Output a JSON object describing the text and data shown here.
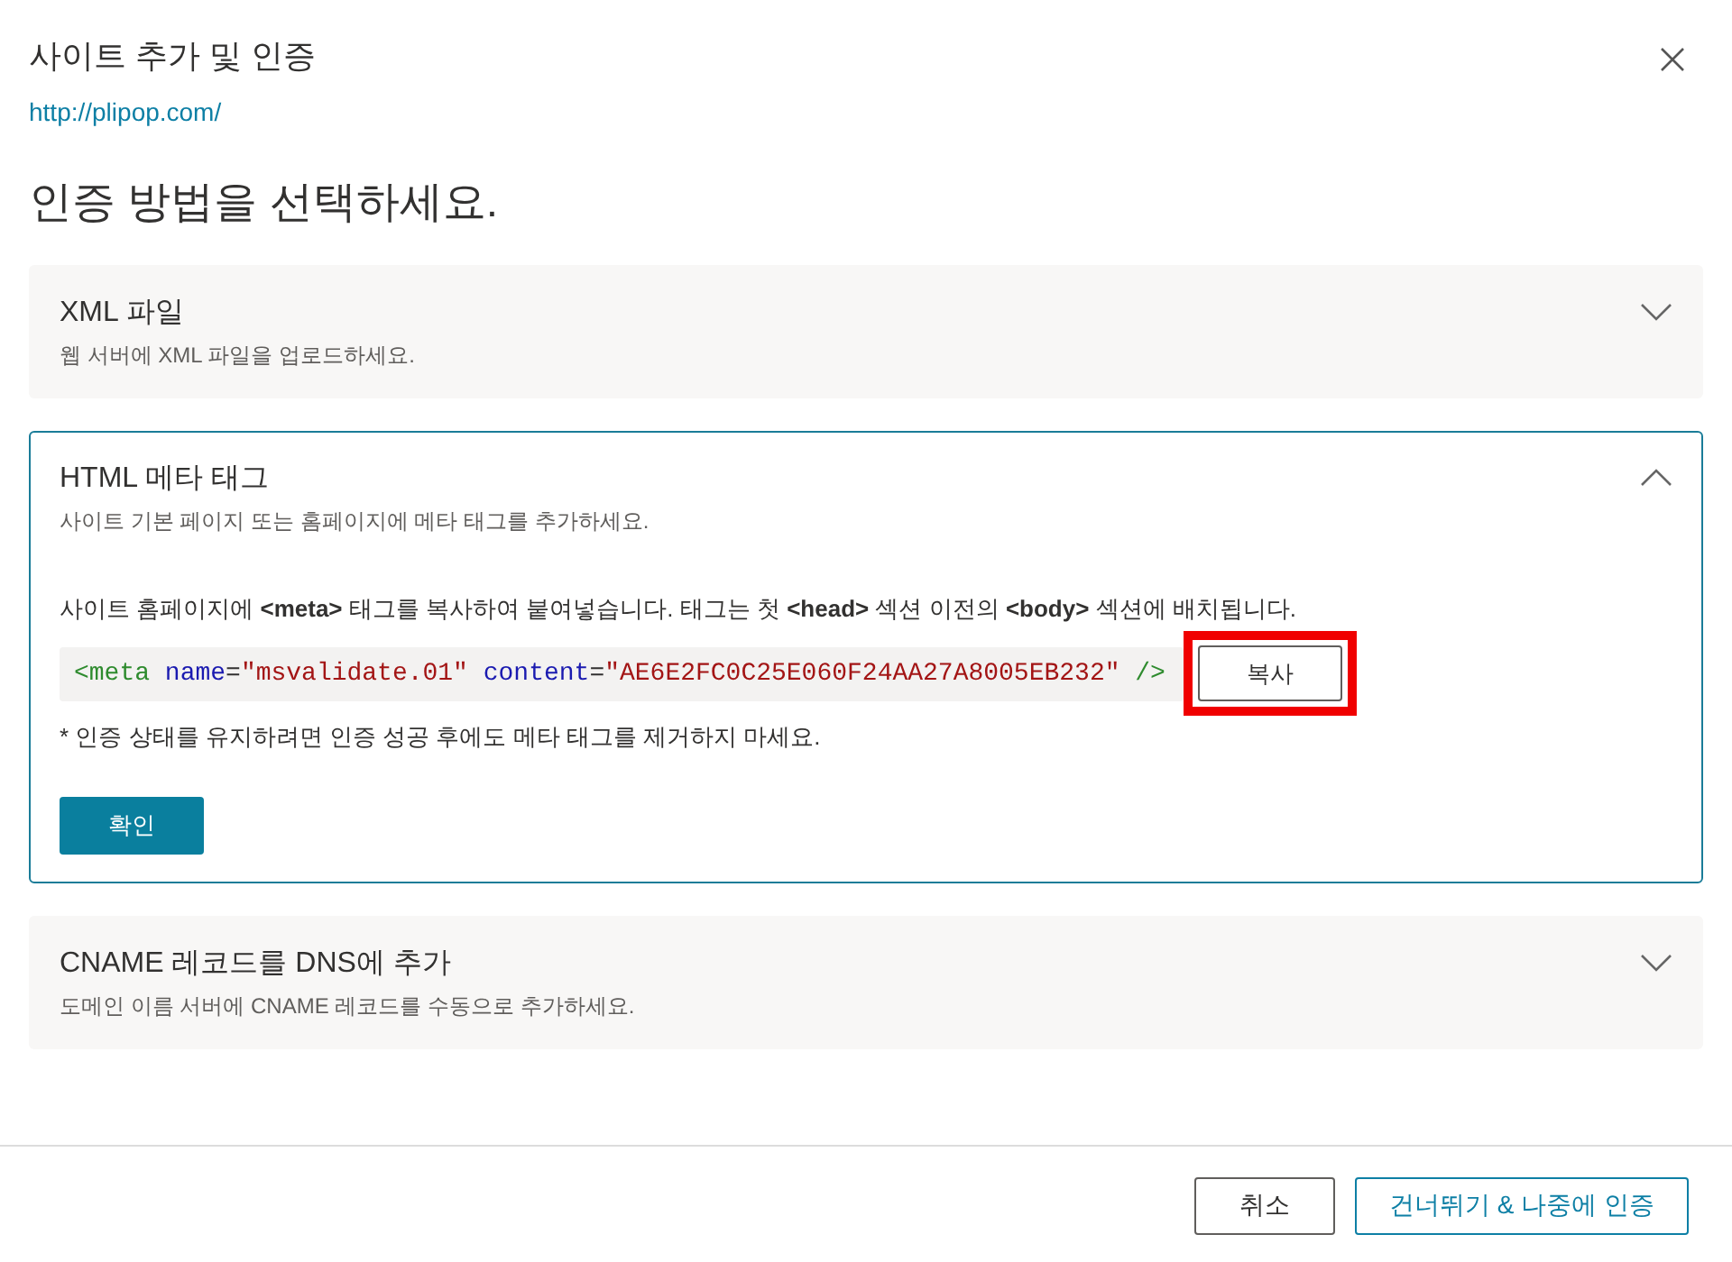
{
  "dialog": {
    "title": "사이트 추가 및 인증",
    "site_url": "http://plipop.com/",
    "heading": "인증 방법을 선택하세요."
  },
  "methods": [
    {
      "title": "XML 파일",
      "description": "웹 서버에 XML 파일을 업로드하세요.",
      "expanded": false
    },
    {
      "title": "HTML 메타 태그",
      "description": "사이트 기본 페이지 또는 홈페이지에 메타 태그를 추가하세요.",
      "expanded": true,
      "instruction": "사이트 홈페이지에 **<meta>** 태그를 복사하여 붙여넣습니다. 태그는 첫 **<head>** 섹션 이전의 **<body>** 섹션에 배치됩니다.",
      "code": [
        {
          "kind": "tag",
          "text": "<meta"
        },
        {
          "kind": "attr",
          "text": " name"
        },
        {
          "kind": "punct",
          "text": "="
        },
        {
          "kind": "string",
          "text": "\"msvalidate.01\""
        },
        {
          "kind": "attr",
          "text": " content"
        },
        {
          "kind": "punct",
          "text": "="
        },
        {
          "kind": "string",
          "text": "\"AE6E2FC0C25E060F24AA27A8005EB232\""
        },
        {
          "kind": "tag",
          "text": " />"
        }
      ],
      "copy_button": {
        "label": "복사",
        "highlighted": true
      },
      "note": "* 인증 상태를 유지하려면 인증 성공 후에도 메타 태그를 제거하지 마세요.",
      "confirm_button": "확인"
    },
    {
      "title": "CNAME 레코드를 DNS에 추가",
      "description": "도메인 이름 서버에 CNAME 레코드를 수동으로 추가하세요.",
      "expanded": false
    }
  ],
  "footer": {
    "buttons": [
      {
        "label": "취소",
        "kind": "secondary"
      },
      {
        "label": "건너뛰기 & 나중에 인증",
        "kind": "outline"
      }
    ]
  }
}
